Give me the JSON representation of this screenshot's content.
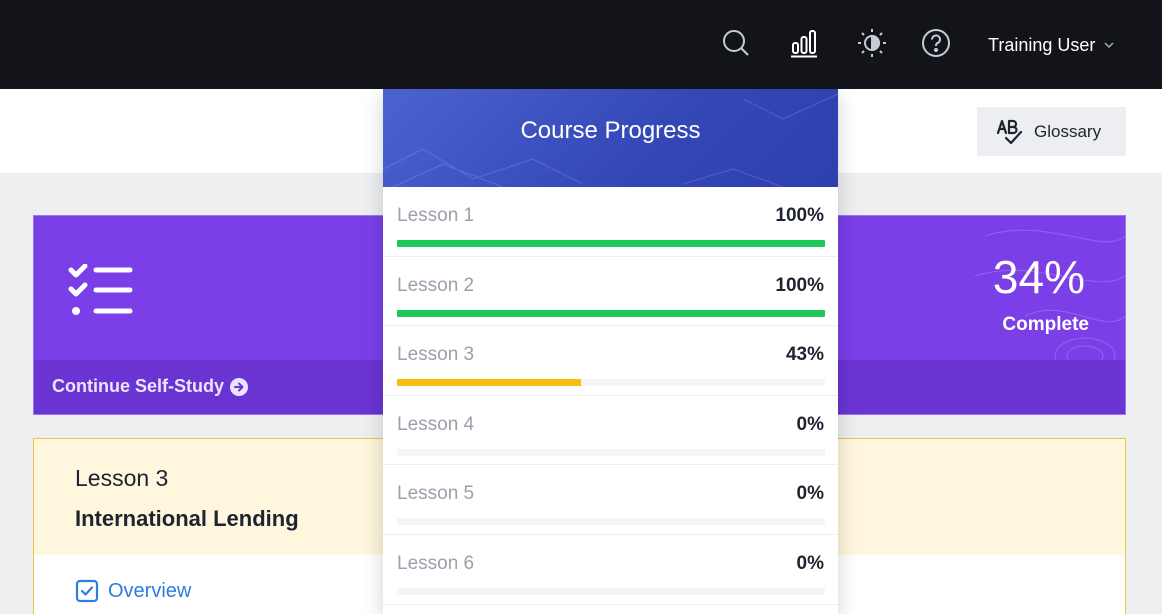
{
  "colors": {
    "topbar": "#12141a",
    "banner": "#7b3fe8",
    "banner_footer": "#6a34d3",
    "panel_header": "#3a4fbf",
    "complete": "#1fc65a",
    "partial": "#f7be0c",
    "track": "#f4f5f6",
    "link": "#2b7fe0"
  },
  "topbar": {
    "icons": [
      "search-icon",
      "bar-chart-icon",
      "brightness-icon",
      "help-icon"
    ],
    "user_name": "Training User"
  },
  "subheader": {
    "glossary_icon": "spellcheck-icon",
    "glossary_label": "Glossary"
  },
  "banner": {
    "icon": "checklist-icon",
    "percent": "34%",
    "percent_label": "Complete",
    "continue_label": "Continue Self-Study"
  },
  "lesson_card": {
    "number": "Lesson 3",
    "title": "International Lending",
    "overview_label": "Overview"
  },
  "progress_panel": {
    "title": "Course Progress",
    "lessons": [
      {
        "label": "Lesson 1",
        "percent": "100%",
        "value": 100
      },
      {
        "label": "Lesson 2",
        "percent": "100%",
        "value": 100
      },
      {
        "label": "Lesson 3",
        "percent": "43%",
        "value": 43
      },
      {
        "label": "Lesson 4",
        "percent": "0%",
        "value": 0
      },
      {
        "label": "Lesson 5",
        "percent": "0%",
        "value": 0
      },
      {
        "label": "Lesson 6",
        "percent": "0%",
        "value": 0
      }
    ]
  }
}
